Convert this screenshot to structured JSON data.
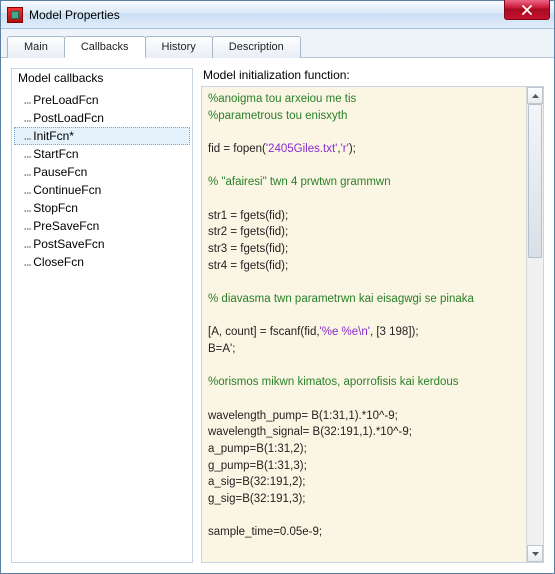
{
  "window": {
    "title": "Model Properties"
  },
  "tabs": [
    {
      "label": "Main",
      "active": false
    },
    {
      "label": "Callbacks",
      "active": true
    },
    {
      "label": "History",
      "active": false
    },
    {
      "label": "Description",
      "active": false
    }
  ],
  "leftpanel": {
    "title": "Model callbacks",
    "items": [
      {
        "label": "PreLoadFcn",
        "selected": false
      },
      {
        "label": "PostLoadFcn",
        "selected": false
      },
      {
        "label": "InitFcn*",
        "selected": true
      },
      {
        "label": "StartFcn",
        "selected": false
      },
      {
        "label": "PauseFcn",
        "selected": false
      },
      {
        "label": "ContinueFcn",
        "selected": false
      },
      {
        "label": "StopFcn",
        "selected": false
      },
      {
        "label": "PreSaveFcn",
        "selected": false
      },
      {
        "label": "PostSaveFcn",
        "selected": false
      },
      {
        "label": "CloseFcn",
        "selected": false
      }
    ]
  },
  "rightpanel": {
    "label": "Model initialization function:",
    "code_lines": [
      {
        "t": "cmt",
        "v": "%anoigma tou arxeiou me tis "
      },
      {
        "t": "cmt",
        "v": "%parametrous tou enisxyth"
      },
      {
        "t": "",
        "v": ""
      },
      {
        "t": "mix",
        "v": "fid = fopen('2405Giles.txt','r');",
        "strs": [
          "'2405Giles.txt'",
          "'r'"
        ]
      },
      {
        "t": "",
        "v": ""
      },
      {
        "t": "cmt",
        "v": "% \"afairesi\" twn 4 prwtwn grammwn"
      },
      {
        "t": "",
        "v": ""
      },
      {
        "t": "",
        "v": "str1 = fgets(fid);"
      },
      {
        "t": "",
        "v": "str2 = fgets(fid);"
      },
      {
        "t": "",
        "v": "str3 = fgets(fid);"
      },
      {
        "t": "",
        "v": "str4 = fgets(fid);"
      },
      {
        "t": "",
        "v": ""
      },
      {
        "t": "cmt",
        "v": "% diavasma twn parametrwn kai eisagwgi se pinaka"
      },
      {
        "t": "",
        "v": ""
      },
      {
        "t": "mix",
        "v": "[A, count] = fscanf(fid,'%e %e\\n', [3 198]);",
        "strs": [
          "'%e %e\\n'"
        ]
      },
      {
        "t": "",
        "v": "B=A';"
      },
      {
        "t": "",
        "v": ""
      },
      {
        "t": "cmt",
        "v": "%orismos mikwn kimatos, aporrofisis kai kerdous"
      },
      {
        "t": "",
        "v": ""
      },
      {
        "t": "",
        "v": "wavelength_pump= B(1:31,1).*10^-9;"
      },
      {
        "t": "",
        "v": "wavelength_signal= B(32:191,1).*10^-9;"
      },
      {
        "t": "",
        "v": "a_pump=B(1:31,2);"
      },
      {
        "t": "",
        "v": "g_pump=B(1:31,3);"
      },
      {
        "t": "",
        "v": "a_sig=B(32:191,2);"
      },
      {
        "t": "",
        "v": "g_sig=B(32:191,3);"
      },
      {
        "t": "",
        "v": ""
      },
      {
        "t": "",
        "v": "sample_time=0.05e-9;"
      }
    ]
  }
}
